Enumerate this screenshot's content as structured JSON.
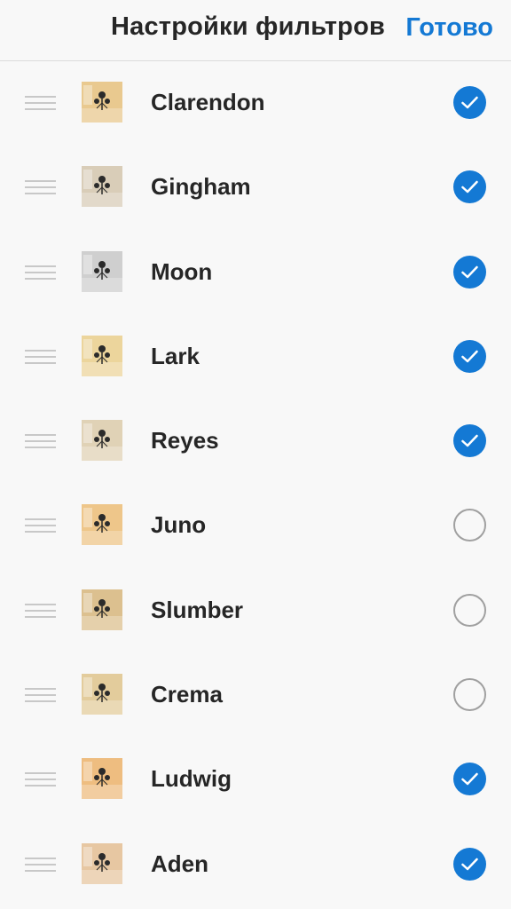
{
  "header": {
    "title": "Настройки фильтров",
    "done_label": "Готово"
  },
  "colors": {
    "accent": "#1479d4",
    "text": "#262626",
    "divider": "#dbdbdb",
    "handle": "#c8c8c8",
    "unchecked_border": "#a0a0a0"
  },
  "filters": [
    {
      "name": "Clarendon",
      "checked": true,
      "tint": "#e9c98f"
    },
    {
      "name": "Gingham",
      "checked": true,
      "tint": "#d9cdb8"
    },
    {
      "name": "Moon",
      "checked": true,
      "tint": "#cfcfcf"
    },
    {
      "name": "Lark",
      "checked": true,
      "tint": "#ecd59c"
    },
    {
      "name": "Reyes",
      "checked": true,
      "tint": "#e0d2b6"
    },
    {
      "name": "Juno",
      "checked": false,
      "tint": "#eec68a"
    },
    {
      "name": "Slumber",
      "checked": false,
      "tint": "#dcc08f"
    },
    {
      "name": "Crema",
      "checked": false,
      "tint": "#e3cc9c"
    },
    {
      "name": "Ludwig",
      "checked": true,
      "tint": "#eebd80"
    },
    {
      "name": "Aden",
      "checked": true,
      "tint": "#e7c7a2"
    }
  ],
  "icons": {
    "handle": "drag-handle-icon",
    "checked": "checkmark-circle-icon",
    "unchecked": "empty-circle-icon"
  }
}
